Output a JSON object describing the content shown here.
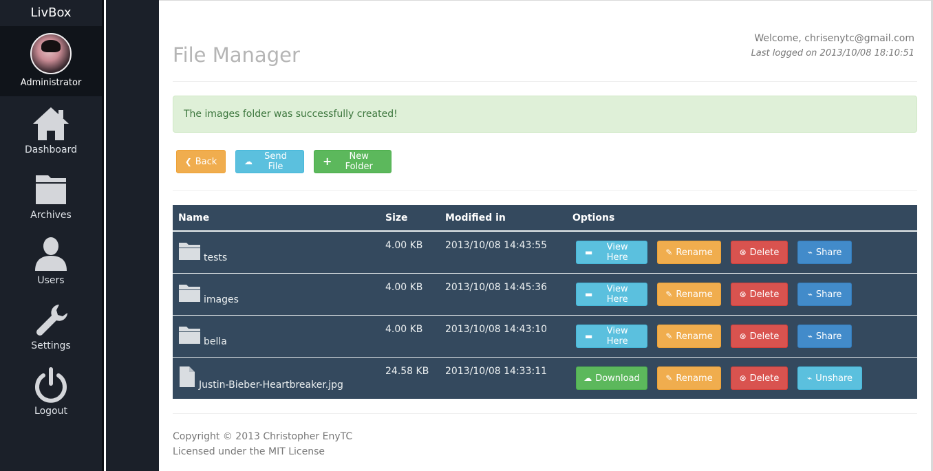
{
  "app": {
    "brand": "LivBox"
  },
  "profile": {
    "role": "Administrator"
  },
  "nav": [
    {
      "label": "Dashboard",
      "icon": "home-icon"
    },
    {
      "label": "Archives",
      "icon": "folder-icon"
    },
    {
      "label": "Users",
      "icon": "user-icon"
    },
    {
      "label": "Settings",
      "icon": "wrench-icon"
    },
    {
      "label": "Logout",
      "icon": "power-icon"
    }
  ],
  "header": {
    "title": "File Manager",
    "welcome": "Welcome, chrisenytc@gmail.com",
    "last_logged": "Last logged on 2013/10/08 18:10:51"
  },
  "alert": {
    "message": "The images folder was successfully created!"
  },
  "toolbar": {
    "back_label": "Back",
    "send_label": "Send File",
    "new_folder_label": "New Folder"
  },
  "table": {
    "headers": {
      "name": "Name",
      "size": "Size",
      "modified": "Modified in",
      "options": "Options"
    },
    "rows": [
      {
        "type": "folder",
        "name": "tests",
        "size": "4.00 KB",
        "modified": "2013/10/08 14:43:55",
        "primary_action": "View Here",
        "rename": "Rename",
        "delete": "Delete",
        "share": "Share"
      },
      {
        "type": "folder",
        "name": "images",
        "size": "4.00 KB",
        "modified": "2013/10/08 14:45:36",
        "primary_action": "View Here",
        "rename": "Rename",
        "delete": "Delete",
        "share": "Share"
      },
      {
        "type": "folder",
        "name": "bella",
        "size": "4.00 KB",
        "modified": "2013/10/08 14:43:10",
        "primary_action": "View Here",
        "rename": "Rename",
        "delete": "Delete",
        "share": "Share"
      },
      {
        "type": "file",
        "name": "Justin-Bieber-Heartbreaker.jpg",
        "size": "24.58 KB",
        "modified": "2013/10/08 14:33:11",
        "primary_action": "Download",
        "rename": "Rename",
        "delete": "Delete",
        "share": "Unshare"
      }
    ]
  },
  "footer": {
    "copyright": "Copyright © 2013 Christopher EnyTC",
    "license": "Licensed under the MIT License"
  },
  "colors": {
    "sidebar_bg": "#1b2029",
    "table_bg": "#34495e",
    "alert_bg": "#dff0d8",
    "warning": "#f0ad4e",
    "info": "#5bc0de",
    "success": "#5cb85c",
    "danger": "#d9534f",
    "primary": "#428bca"
  }
}
